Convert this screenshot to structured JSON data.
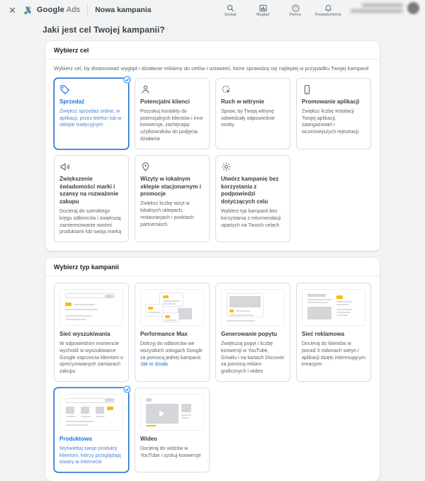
{
  "topbar": {
    "brand_google": "Google",
    "brand_ads": "Ads",
    "page_name": "Nowa kampania",
    "close_label": "✕",
    "actions": [
      {
        "label": "Szukaj"
      },
      {
        "label": "Wygląd"
      },
      {
        "label": "Pomoc"
      },
      {
        "label": "Powiadomienia"
      }
    ]
  },
  "page_title": "Jaki jest cel Twojej kampanii?",
  "goal_section": {
    "title": "Wybierz cel",
    "description": "Wybierz cel, by dostosować wygląd i działanie reklamy do celów i ustawień, które sprawdzą się najlepiej w przypadku Twojej kampanii",
    "cards": [
      {
        "title": "Sprzedaż",
        "description": "Zwiększ sprzedaż online, w aplikacji, przez telefon lub w sklepie tradycyjnym",
        "selected": true
      },
      {
        "title": "Potencjalni klienci",
        "description": "Pozyskuj kontakty do potencjalnych klientów i inne konwersje, zachęcając użytkowników do podjęcia działania",
        "selected": false
      },
      {
        "title": "Ruch w witrynie",
        "description": "Spraw, by Twoją witrynę odwiedzały odpowiednie osoby",
        "selected": false
      },
      {
        "title": "Promowanie aplikacji",
        "description": "Zwiększ liczbę instalacji Twojej aplikacji, zaangażowań i wcześniejszych rejestracji",
        "selected": false
      },
      {
        "title": "Zwiększenie świadomości marki i szansy na rozważenie zakupu",
        "description": "Docieraj do szerokiego kręgu odbiorców i zwiększaj zainteresowanie swoimi produktami lub swoją marką",
        "selected": false
      },
      {
        "title": "Wizyty w lokalnym sklepie stacjonarnym i promocje",
        "description": "Zwiększ liczbę wizyt w lokalnych sklepach, restauracjach i punktach partnerskich",
        "selected": false
      },
      {
        "title": "Utwórz kampanię bez korzystania z podpowiedzi dotyczących celu",
        "description": "Wybierz typ kampanii bez korzystania z rekomendacji opartych na Twoich celach",
        "selected": false
      }
    ]
  },
  "type_section": {
    "title": "Wybierz typ kampanii",
    "cards": [
      {
        "title": "Sieć wyszukiwania",
        "description": "W odpowiednim momencie wychodź w wyszukiwarce Google naprzeciw klientom o sprecyzowanych zamiarach zakupu",
        "selected": false
      },
      {
        "title": "Performance Max",
        "description": "Dotrzyj do odbiorców we wszystkich usługach Google za pomocą jednej kampanii.",
        "link_label": "Jak to działa",
        "selected": false
      },
      {
        "title": "Generowanie popytu",
        "description": "Zwiększaj popyt i liczbę konwersji w YouTube, Gmailu i na kartach Discover za pomocą reklam graficznych i wideo",
        "selected": false
      },
      {
        "title": "Sieć reklamowa",
        "description": "Docieraj do klientów w ponad 3 milionach witryn i aplikacji dzięki interesującym kreacjom",
        "selected": false
      },
      {
        "title": "Produktowa",
        "description": "Wyświetlaj swoje produkty klientom, którzy przeglądają towary w internecie",
        "selected": true
      },
      {
        "title": "Wideo",
        "description": "Docieraj do widzów w YouTube i zyskuj konwersje",
        "selected": false
      }
    ]
  },
  "colors": {
    "accent_blue": "#1a73e8",
    "selected_border": "#1967d2",
    "ad_badge_yellow": "#fbbc04",
    "background_gray": "#f1f3f4",
    "text_secondary": "#5f6368"
  }
}
